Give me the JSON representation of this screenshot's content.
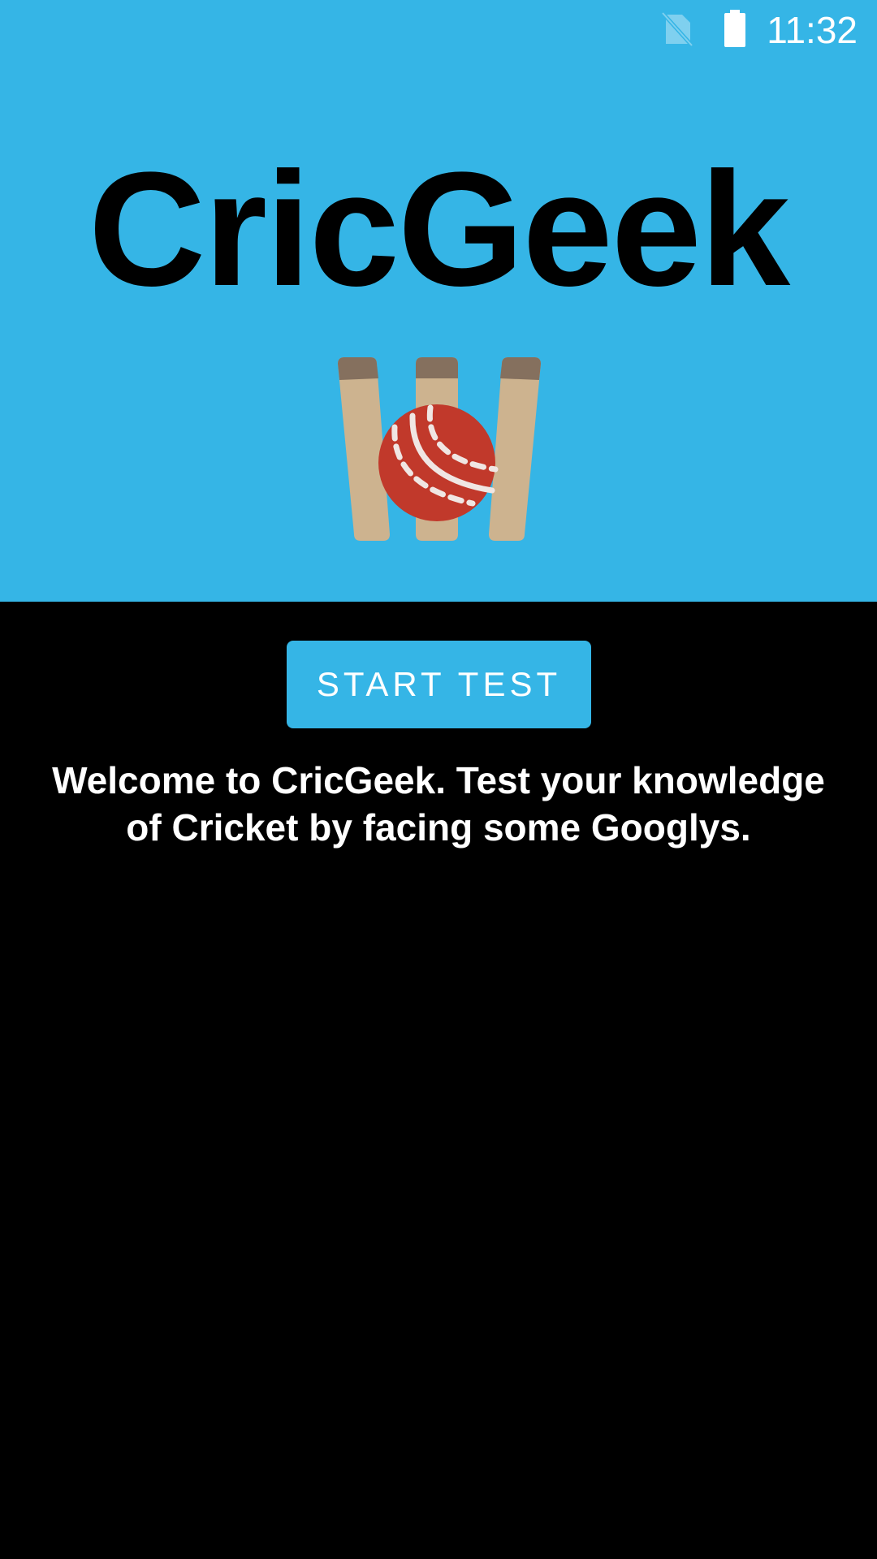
{
  "status_bar": {
    "time": "11:32",
    "icons": [
      "no-sim-icon",
      "battery-full-icon"
    ]
  },
  "app": {
    "title": "CricGeek",
    "logo_icon": "cricket-stumps-ball-icon",
    "start_button_label": "START TEST",
    "welcome_message": "Welcome to CricGeek. Test your knowledge of Cricket by facing some Googlys."
  },
  "colors": {
    "header_background": "#35b5e6",
    "body_background": "#000000",
    "button_background": "#35b5e6",
    "ball_red": "#c1392b",
    "stump_wood": "#cdb38f",
    "bail_brown": "#85705e"
  }
}
